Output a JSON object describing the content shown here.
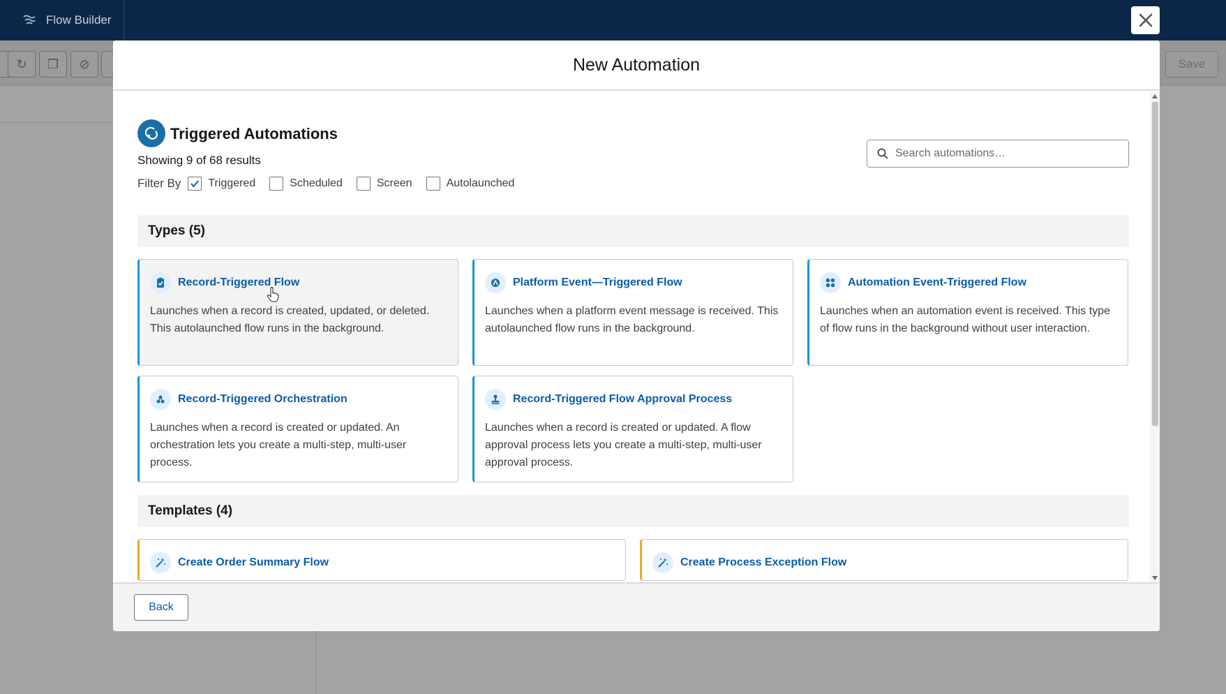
{
  "app": {
    "title": "Flow Builder"
  },
  "toolbar": {
    "save_label": "Save"
  },
  "modal": {
    "title": "New Automation",
    "section": {
      "title": "Triggered Automations",
      "results_text": "Showing 9 of 68 results",
      "search_placeholder": "Search automations…",
      "filter_label": "Filter By",
      "filters": [
        {
          "label": "Triggered",
          "checked": true
        },
        {
          "label": "Scheduled",
          "checked": false
        },
        {
          "label": "Screen",
          "checked": false
        },
        {
          "label": "Autolaunched",
          "checked": false
        }
      ]
    },
    "types": {
      "header": "Types (5)",
      "cards": [
        {
          "title": "Record-Triggered Flow",
          "desc": "Launches when a record is created, updated, or deleted. This autolaunched flow runs in the background.",
          "icon": "record-trigger-icon"
        },
        {
          "title": "Platform Event—Triggered Flow",
          "desc": "Launches when a platform event message is received. This autolaunched flow runs in the background.",
          "icon": "platform-event-icon"
        },
        {
          "title": "Automation Event-Triggered Flow",
          "desc": "Launches when an automation event is received. This type of flow runs in the background without user interaction.",
          "icon": "automation-event-icon"
        },
        {
          "title": "Record-Triggered Orchestration",
          "desc": "Launches when a record is created or updated. An orchestration lets you create a multi-step, multi-user process.",
          "icon": "orchestration-icon"
        },
        {
          "title": "Record-Triggered Flow Approval Process",
          "desc": "Launches when a record is created or updated. A flow approval process lets you create a multi-step, multi-user approval process.",
          "icon": "approval-icon"
        }
      ]
    },
    "templates": {
      "header": "Templates (4)",
      "cards": [
        {
          "title": "Create Order Summary Flow",
          "icon": "magic-wand-icon"
        },
        {
          "title": "Create Process Exception Flow",
          "icon": "magic-wand-icon"
        }
      ]
    },
    "footer": {
      "back_label": "Back"
    }
  },
  "colors": {
    "accent": "#0b5cab",
    "card_border": "#1b96d4",
    "template_border": "#e6a92b",
    "topbar": "#0b2747"
  }
}
